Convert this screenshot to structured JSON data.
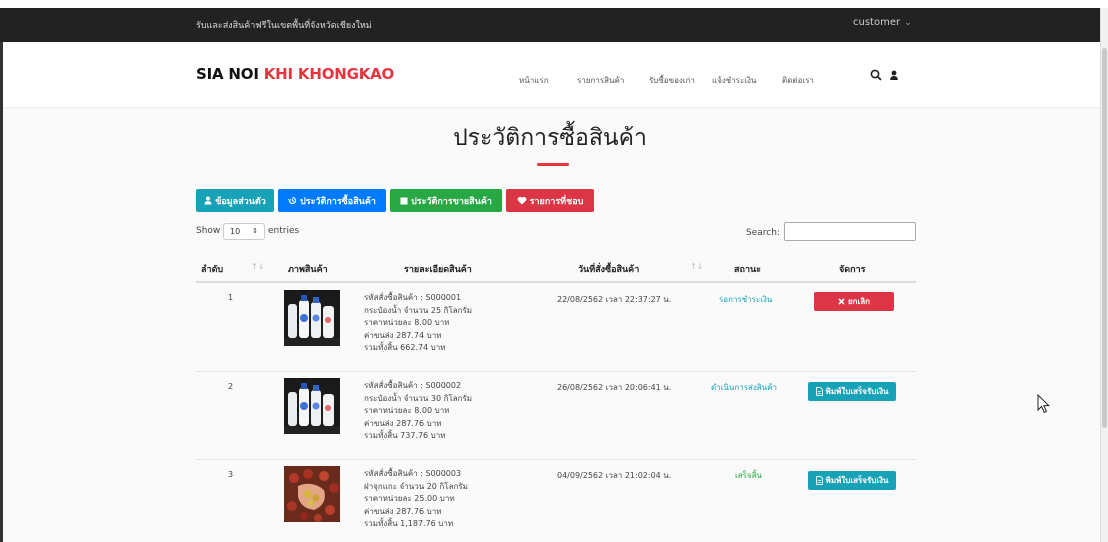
{
  "topbar": {
    "promo": "รับและส่งสินค้าฟรีในเขตพื้นที่จังหวัดเชียงใหม่",
    "user_menu": "customer",
    "caret": "⌄"
  },
  "navbar": {
    "logo_main": "SIA NOI",
    "logo_accent": "KHI KHONGKAO",
    "accent_color": "#e8343f",
    "menu": [
      "หน้าแรก",
      "รายการสินค้า",
      "รับซื้อของเก่า",
      "แจ้งชำระเงิน",
      "ติดต่อเรา"
    ],
    "icons": [
      "search-icon",
      "user-icon"
    ]
  },
  "page": {
    "title": "ประวัติการซื้อสินค้า"
  },
  "tabs": [
    {
      "label": "ข้อมูลส่วนตัว",
      "icon": "user-icon",
      "color": "#17a2b8"
    },
    {
      "label": "ประวัติการซื้อสินค้า",
      "icon": "history-icon",
      "color": "#007bff"
    },
    {
      "label": "ประวัติการขายสินค้า",
      "icon": "square-icon",
      "color": "#28a745"
    },
    {
      "label": "รายการที่ชอบ",
      "icon": "heart-icon",
      "color": "#dc3545"
    }
  ],
  "table_controls": {
    "show_label": "Show",
    "entries_value": "10",
    "entries_label": "entries",
    "search_label": "Search:"
  },
  "table": {
    "headers": [
      "ลำดับ",
      "ภาพสินค้า",
      "รายละเอียดสินค้า",
      "วันที่สั่งซื้อสินค้า",
      "สถานะ",
      "จัดการ"
    ],
    "rows": [
      {
        "no": "1",
        "image": "bottles-photo",
        "details": [
          "รหัสสั่งซื้อสินค้า : S000001",
          "กระป๋องน้ำ จำนวน 25 กิโลกรัม",
          "ราคาหน่วยละ 8.00 บาท",
          "ค่าขนส่ง 287.74 บาท",
          "รวมทั้งสิ้น 662.74 บาท"
        ],
        "date": "22/08/2562 เวลา 22:37:27 น.",
        "status": "รอการชำระเงิน",
        "status_color": "#17a2b8",
        "action": "ยกเลิก",
        "action_icon": "times-icon",
        "action_color": "#dc3545"
      },
      {
        "no": "2",
        "image": "bottles-photo",
        "details": [
          "รหัสสั่งซื้อสินค้า : S000002",
          "กระป๋องน้ำ จำนวน 30 กิโลกรัม",
          "ราคาหน่วยละ 8.00 บาท",
          "ค่าขนส่ง 287.76 บาท",
          "รวมทั้งสิ้น 737.76 บาท"
        ],
        "date": "26/08/2562 เวลา 20:06:41 น.",
        "status": "ดำเนินการส่งสินค้า",
        "status_color": "#17a2b8",
        "action": "พิมพ์ใบเสร็จรับเงิน",
        "action_icon": "file-icon",
        "action_color": "#17a2b8"
      },
      {
        "no": "3",
        "image": "bottle-caps-photo",
        "details": [
          "รหัสสั่งซื้อสินค้า : S000003",
          "ฝาจุกแกะ จำนวน 20 กิโลกรัม",
          "ราคาหน่วยละ 25.00 บาท",
          "ค่าขนส่ง 287.76 บาท",
          "รวมทั้งสิ้น 1,187.76 บาท"
        ],
        "date": "04/09/2562 เวลา 21:02:04 น.",
        "status": "เสร็จสิ้น",
        "status_color": "#28a745",
        "action": "พิมพ์ใบเสร็จรับเงิน",
        "action_icon": "file-icon",
        "action_color": "#17a2b8"
      }
    ]
  }
}
